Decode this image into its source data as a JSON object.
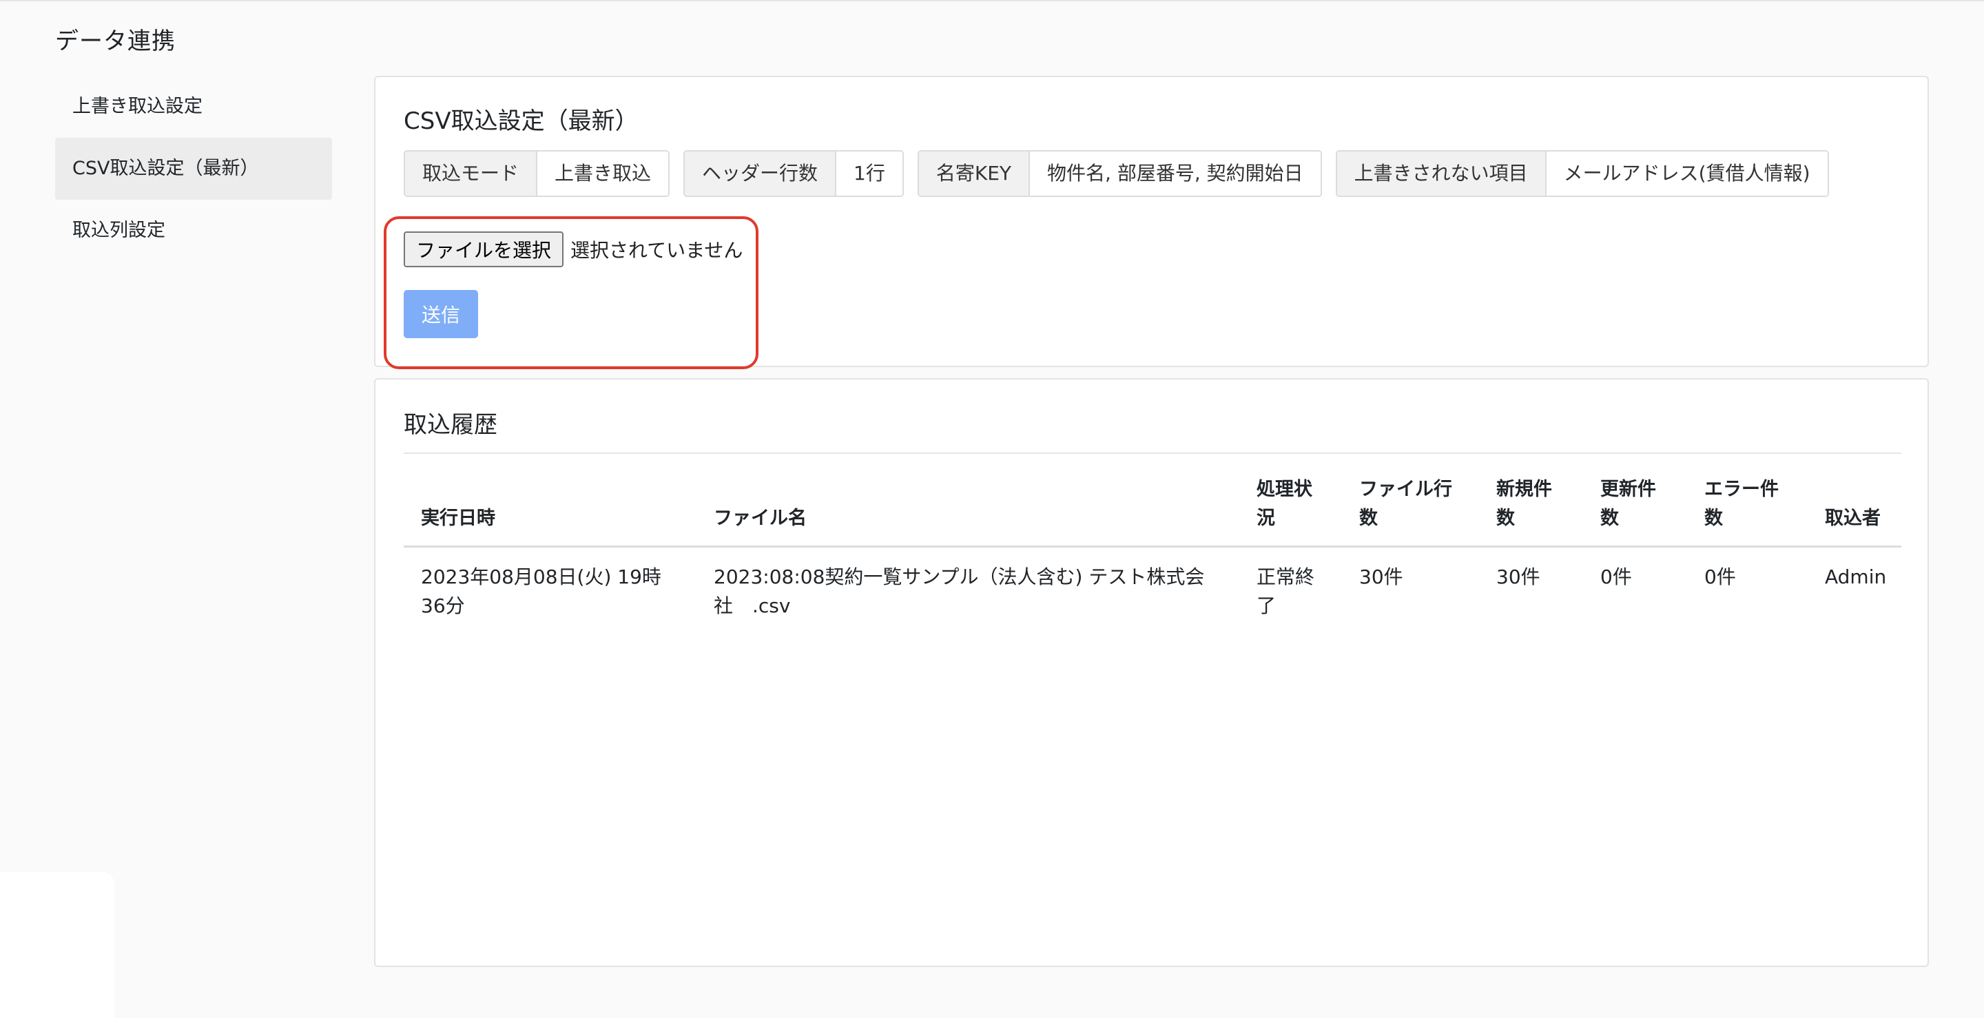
{
  "page": {
    "title": "データ連携"
  },
  "sidebar": {
    "items": [
      {
        "label": "上書き取込設定",
        "active": false
      },
      {
        "label": "CSV取込設定（最新）",
        "active": true
      },
      {
        "label": "取込列設定",
        "active": false
      }
    ]
  },
  "settings": {
    "title": "CSV取込設定（最新）",
    "info": [
      {
        "label": "取込モード",
        "value": "上書き取込"
      },
      {
        "label": "ヘッダー行数",
        "value": "1行"
      },
      {
        "label": "名寄KEY",
        "value": "物件名, 部屋番号, 契約開始日"
      },
      {
        "label": "上書きされない項目",
        "value": "メールアドレス(賃借人情報)"
      }
    ],
    "file_button_label": "ファイルを選択",
    "file_status": "選択されていません",
    "submit_label": "送信",
    "highlight_color": "#e03a2b",
    "submit_color": "#7fadf8"
  },
  "history": {
    "title": "取込履歴",
    "columns": [
      "実行日時",
      "ファイル名",
      "処理状況",
      "ファイル行数",
      "新規件数",
      "更新件数",
      "エラー件数",
      "取込者"
    ],
    "rows": [
      {
        "executed_at": "2023年08月08日(火) 19時36分",
        "file_name": "2023:08:08契約一覧サンプル（法人含む) テスト株式会社　.csv",
        "status": "正常終了",
        "file_rows": "30件",
        "new_count": "30件",
        "updated_count": "0件",
        "error_count": "0件",
        "importer": "Admin"
      }
    ]
  }
}
